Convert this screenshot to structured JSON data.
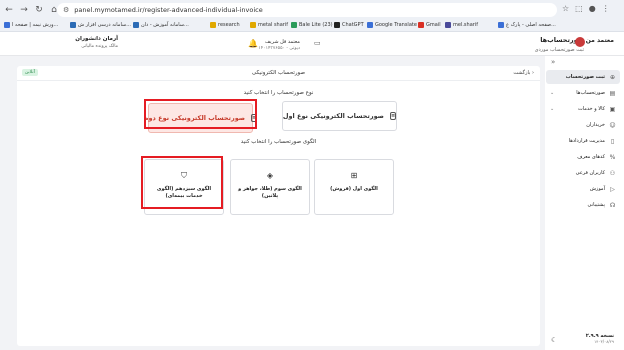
{
  "browser": {
    "url": "panel.mymotamed.ir/register-advanced-individual-invoice",
    "bookmarks": [
      {
        "label": "صفحه اصلی - پارک ع...",
        "color": "#3b6fd6"
      },
      {
        "label": "research",
        "color": "#e0a800"
      },
      {
        "label": "metal sharif",
        "color": "#e0a800"
      },
      {
        "label": "Bale Lite (23)",
        "color": "#2b9b5a"
      },
      {
        "label": "ChatGPT",
        "color": "#222222"
      },
      {
        "label": "Google Translate",
        "color": "#3b6fd6"
      },
      {
        "label": "Gmail",
        "color": "#d93025"
      },
      {
        "label": "mel.sharif",
        "color": "#4a4a9a"
      },
      {
        "label": "سامانه آموزش - دان...",
        "color": "#2b6bb5"
      },
      {
        "label": "سامانه درسی افزار ش...",
        "color": "#2b6bb5"
      },
      {
        "label": "ورش نیمه | صفحه ا...",
        "color": "#3b6fd6"
      }
    ]
  },
  "header": {
    "logo_text": "معتمد من",
    "page_title": "صورتحساب‌ها",
    "page_subtitle": "ثبت صورتحساب موردی",
    "company_name": "معتمد فل شریف",
    "company_id": "۱۴۰۱۴۳۷۶۵۵۰ - دپوتی",
    "user_name": "آرمان دانشوران",
    "user_role": "مالک پرونده مالیاتی"
  },
  "sidebar": {
    "items": [
      {
        "label": "ثبت صورتحساب",
        "icon": "plus-circle-icon",
        "active": true,
        "expandable": false
      },
      {
        "label": "صورتحساب‌ها",
        "icon": "receipt-icon",
        "active": false,
        "expandable": true
      },
      {
        "label": "کالا و خدمات",
        "icon": "box-icon",
        "active": false,
        "expandable": true
      },
      {
        "label": "خریداران",
        "icon": "users-icon",
        "active": false,
        "expandable": false
      },
      {
        "label": "مدیریت قراردادها",
        "icon": "file-icon",
        "active": false,
        "expandable": false
      },
      {
        "label": "کدهای معرف",
        "icon": "percent-icon",
        "active": false,
        "expandable": false
      },
      {
        "label": "کاربران فرعی",
        "icon": "user-plus-icon",
        "active": false,
        "expandable": false
      },
      {
        "label": "آموزش",
        "icon": "play-icon",
        "active": false,
        "expandable": false
      },
      {
        "label": "پشتیبانی",
        "icon": "headset-icon",
        "active": false,
        "expandable": false
      }
    ],
    "version_label": "نسخه ۲.۹.۹",
    "version_date": "۱۴۰۳/۰۸/۲۹"
  },
  "card": {
    "title": "صورتحساب الکترونیکی",
    "back_label": "بازگشت",
    "badge": "آنلاین",
    "type_section_label": "نوع صورتحساب را انتخاب کنید",
    "types": [
      {
        "label": "صورتحساب الکترونیکی نوع اول",
        "selected": false
      },
      {
        "label": "صورتحساب الکترونیکی نوع دوم",
        "selected": true
      }
    ],
    "pattern_section_label": "الگوی صورتحساب را انتخاب کنید",
    "patterns": [
      {
        "label": "الگوی اول (فروش)",
        "icon": "qr-icon"
      },
      {
        "label": "الگوی سوم (طلا، جواهر و پلاتین)",
        "icon": "gem-icon"
      },
      {
        "label": "الگوی سیزدهم (الگوی خدمات بیمه‌ای)",
        "icon": "shield-check-icon"
      }
    ]
  },
  "colors": {
    "accent": "#c73b2b",
    "selected_bg": "#fde7e4",
    "highlight_border": "#e51c23"
  }
}
